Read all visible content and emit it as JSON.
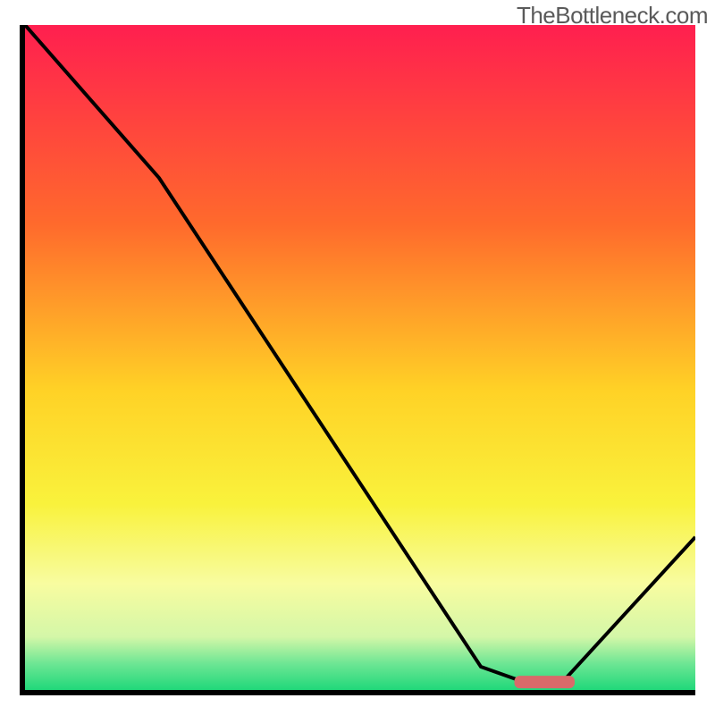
{
  "watermark": "TheBottleneck.com",
  "chart_data": {
    "type": "line",
    "title": "",
    "xlabel": "",
    "ylabel": "",
    "xlim": [
      0,
      100
    ],
    "ylim": [
      0,
      100
    ],
    "x": [
      0,
      20,
      68,
      75,
      80,
      100
    ],
    "values": [
      100,
      77,
      3.5,
      1,
      1,
      23
    ],
    "marker": {
      "x_start": 73,
      "x_end": 82,
      "y": 1.2,
      "color": "#d96a6a"
    },
    "gradient_stops": [
      {
        "offset": 0,
        "color": "#ff1f4f"
      },
      {
        "offset": 30,
        "color": "#ff6a2c"
      },
      {
        "offset": 55,
        "color": "#ffd226"
      },
      {
        "offset": 72,
        "color": "#f9f23c"
      },
      {
        "offset": 84,
        "color": "#f8fca0"
      },
      {
        "offset": 92,
        "color": "#d4f7a8"
      },
      {
        "offset": 96,
        "color": "#6ee694"
      },
      {
        "offset": 100,
        "color": "#20d87a"
      }
    ],
    "border_color": "#000000",
    "line_color": "#000000"
  }
}
